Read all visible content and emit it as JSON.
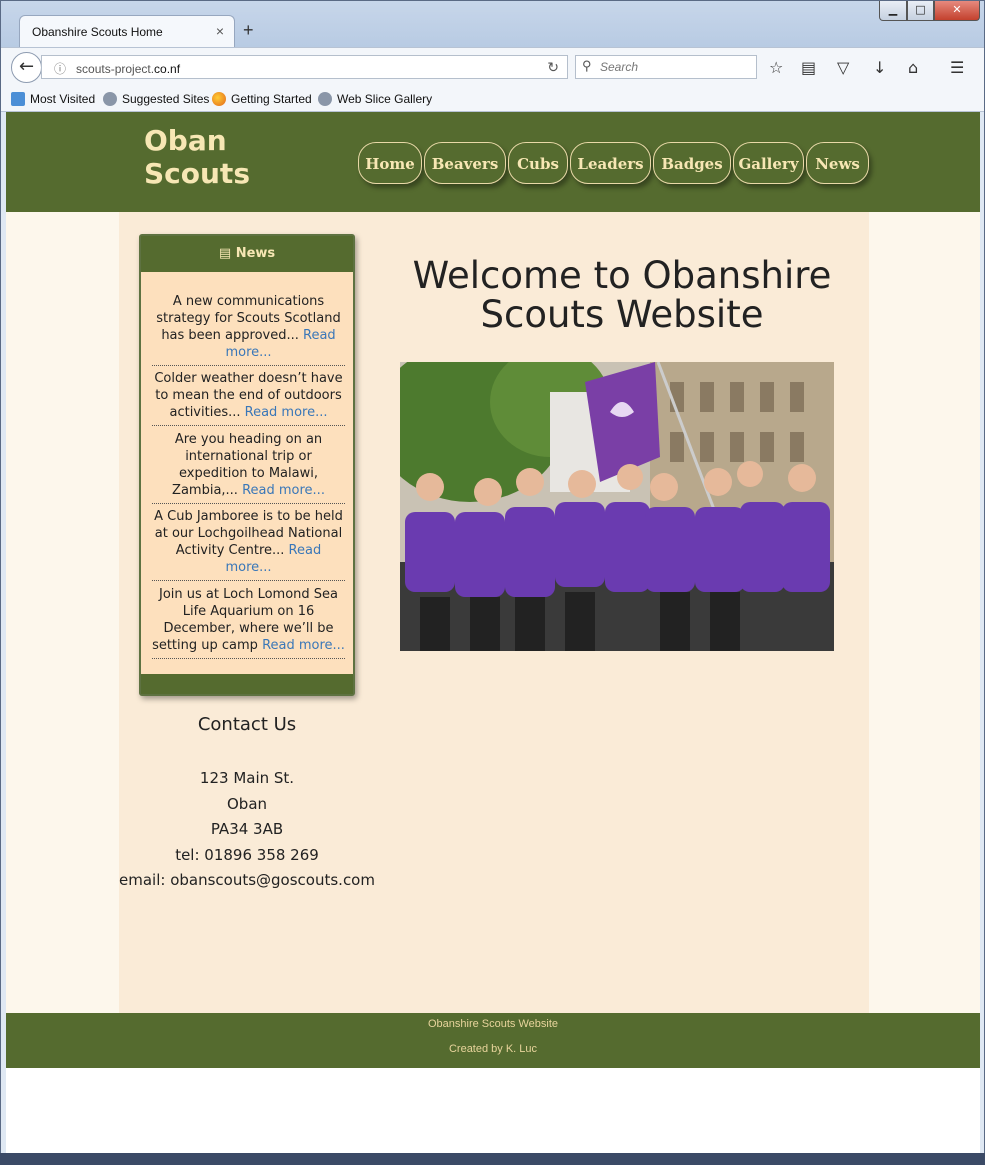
{
  "browser": {
    "tab_title": "Obanshire Scouts Home",
    "tab_close": "×",
    "new_tab": "+",
    "url_prefix": "scouts-project.",
    "url_domain": "co.nf",
    "search_placeholder": "Search",
    "window_controls": {
      "minimize": "▁",
      "maximize": "□",
      "close": "✕"
    },
    "bookmarks": [
      "Most Visited",
      "Suggested Sites",
      "Getting Started",
      "Web Slice Gallery"
    ]
  },
  "site": {
    "logo_line1": "Oban",
    "logo_line2": "Scouts",
    "nav": [
      "Home",
      "Beavers",
      "Cubs",
      "Leaders",
      "Badges",
      "Gallery",
      "News"
    ],
    "colors": {
      "header_green": "#556b2f",
      "cream": "#f7e7b4",
      "panel": "#faebd7",
      "link": "#3a77b8"
    }
  },
  "news": {
    "heading": "News",
    "icon": "newspaper-icon",
    "items": [
      {
        "text": "A new communications strategy for Scouts Scotland has been approved... ",
        "link": "Read more..."
      },
      {
        "text": "Colder weather doesn’t have to mean the end of outdoors activities... ",
        "link": "Read more..."
      },
      {
        "text": "Are you heading on an international trip or expedition to Malawi, Zambia,... ",
        "link": "Read more..."
      },
      {
        "text": "A Cub Jamboree is to be held at our Lochgoilhead National Activity Centre... ",
        "link": "Read more..."
      },
      {
        "text": "Join us at Loch Lomond Sea Life Aquarium on 16 December, where we’ll be setting up camp ",
        "link": "Read more..."
      }
    ]
  },
  "contact": {
    "heading": "Contact Us",
    "address1": "123 Main St.",
    "address2": "Oban",
    "postcode": "PA34 3AB",
    "tel": "tel: 01896 358 269",
    "email": "email: obanscouts@goscouts.com"
  },
  "main": {
    "welcome": "Welcome to Obanshire Scouts Website"
  },
  "footer": {
    "line1": "Obanshire Scouts Website",
    "line2": "Created by K. Luc"
  }
}
